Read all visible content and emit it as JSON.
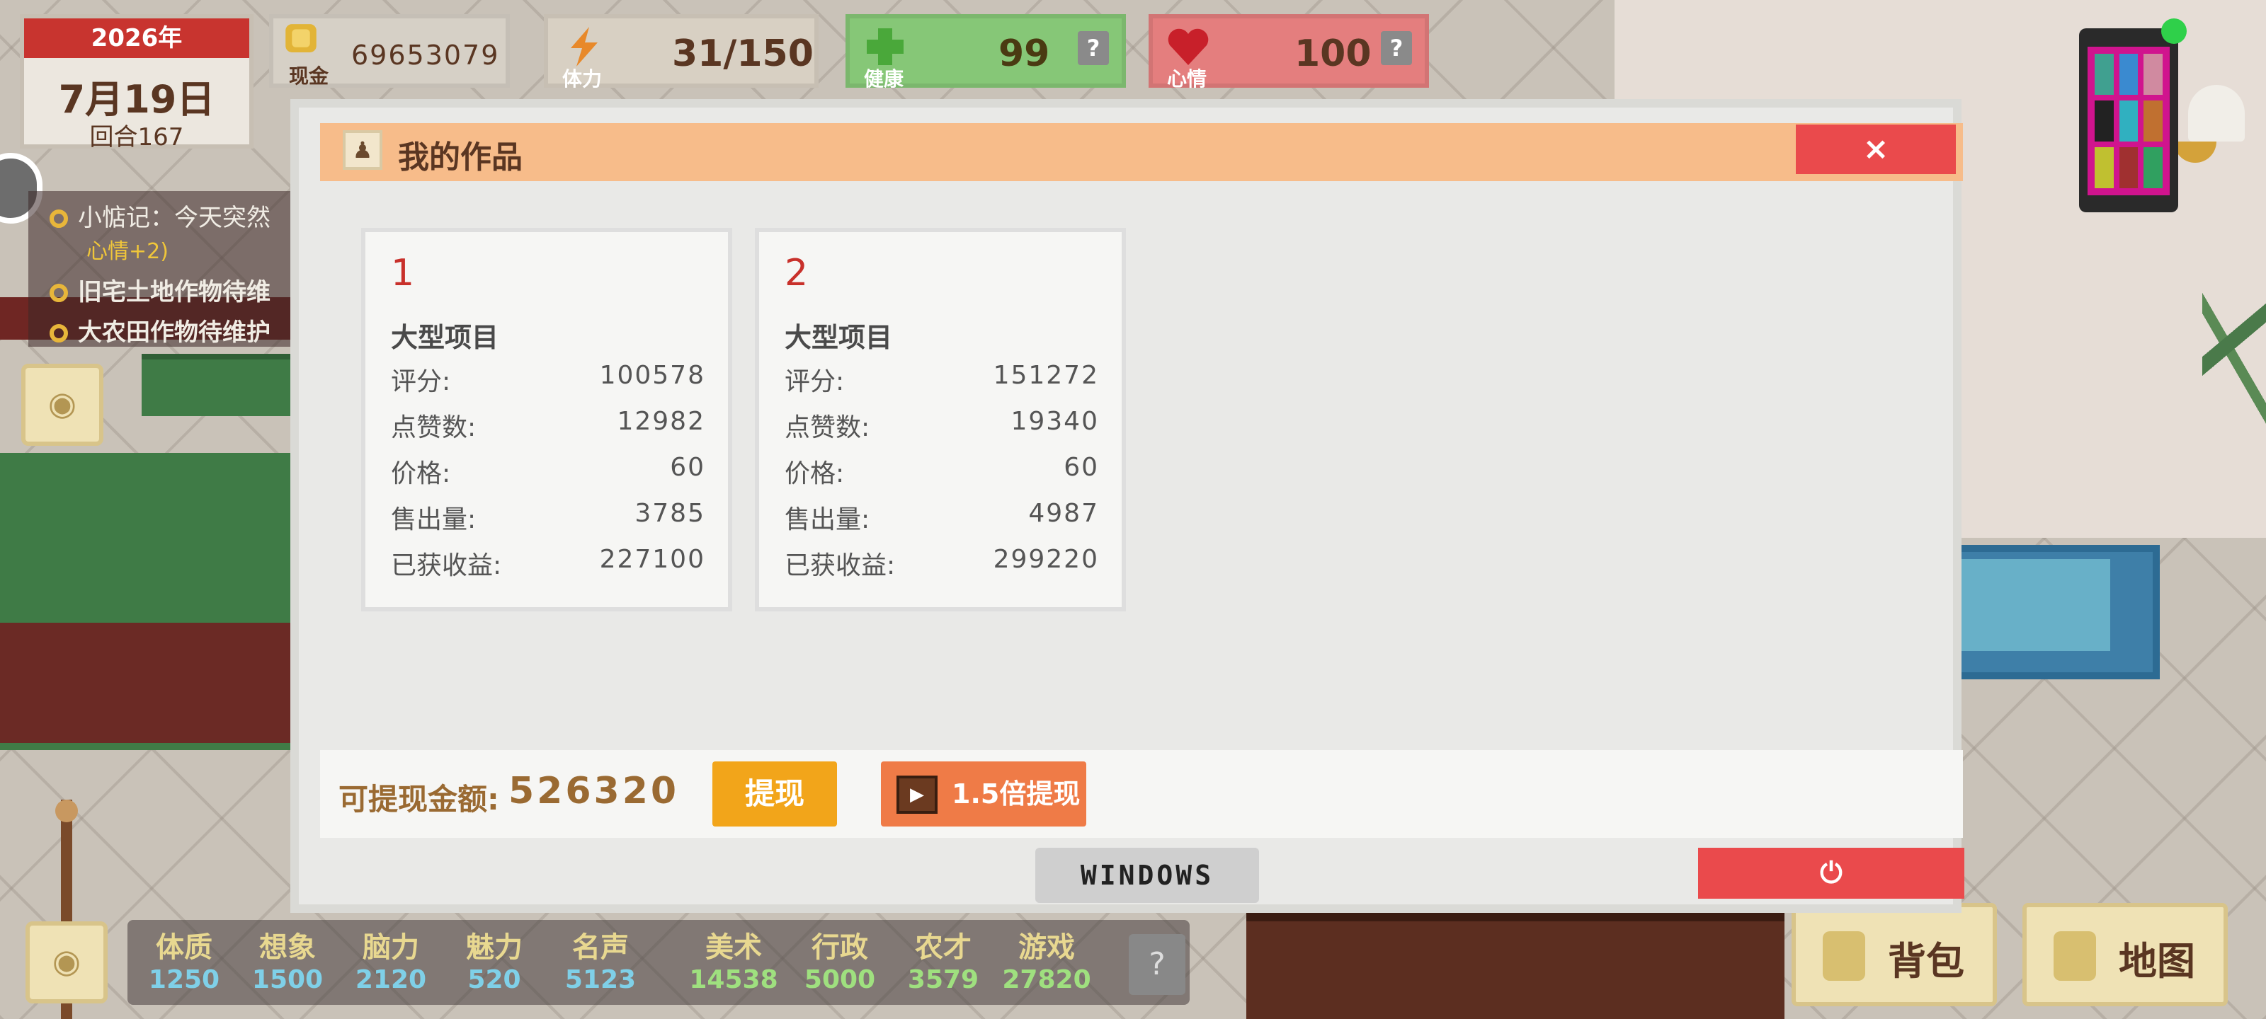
{
  "hud": {
    "year": "2026年",
    "date": "7月19日",
    "round": "回合167",
    "cash_label": "现金",
    "cash_value": "69653079",
    "energy_label": "体力",
    "energy_value": "31/150",
    "health_label": "健康",
    "health_value": "99",
    "mood_label": "心情",
    "mood_value": "100",
    "help_symbol": "?"
  },
  "quests": [
    {
      "text": "小惦记：今天突然"
    },
    {
      "text": "旧宅土地作物待维"
    },
    {
      "text": "大农田作物待维护"
    }
  ],
  "quest_note": "心情+2)",
  "modal": {
    "title": "我的作品",
    "close_symbol": "×",
    "works": [
      {
        "index": "1",
        "type": "大型项目",
        "rows": [
          {
            "k": "评分:",
            "v": "100578"
          },
          {
            "k": "点赞数:",
            "v": "12982"
          },
          {
            "k": "价格:",
            "v": "60"
          },
          {
            "k": "售出量:",
            "v": "3785"
          },
          {
            "k": "已获收益:",
            "v": "227100"
          }
        ]
      },
      {
        "index": "2",
        "type": "大型项目",
        "rows": [
          {
            "k": "评分:",
            "v": "151272"
          },
          {
            "k": "点赞数:",
            "v": "19340"
          },
          {
            "k": "价格:",
            "v": "60"
          },
          {
            "k": "售出量:",
            "v": "4987"
          },
          {
            "k": "已获收益:",
            "v": "299220"
          }
        ]
      }
    ],
    "withdraw_label": "可提现金额:",
    "withdraw_value": "526320",
    "withdraw_button": "提现",
    "withdraw_15_button": "1.5倍提现",
    "windows_button": "WINDOWS",
    "power_symbol": "⏻"
  },
  "attributes": [
    {
      "name": "体质",
      "value": "1250",
      "color": "blue"
    },
    {
      "name": "想象",
      "value": "1500",
      "color": "blue"
    },
    {
      "name": "脑力",
      "value": "2120",
      "color": "blue"
    },
    {
      "name": "魅力",
      "value": "520",
      "color": "blue"
    },
    {
      "name": "名声",
      "value": "5123",
      "color": "blue"
    },
    {
      "name": "美术",
      "value": "14538",
      "color": "green"
    },
    {
      "name": "行政",
      "value": "5000",
      "color": "green"
    },
    {
      "name": "农才",
      "value": "3579",
      "color": "green"
    },
    {
      "name": "游戏",
      "value": "27820",
      "color": "green"
    }
  ],
  "attr_help": "?",
  "buttons": {
    "backpack": "背包",
    "map": "地图"
  },
  "colors": {
    "header_orange": "#f7bc8a",
    "close_red": "#ea4a4c",
    "withdraw_yellow": "#f2a51a",
    "withdraw_orange": "#ef7b47"
  }
}
